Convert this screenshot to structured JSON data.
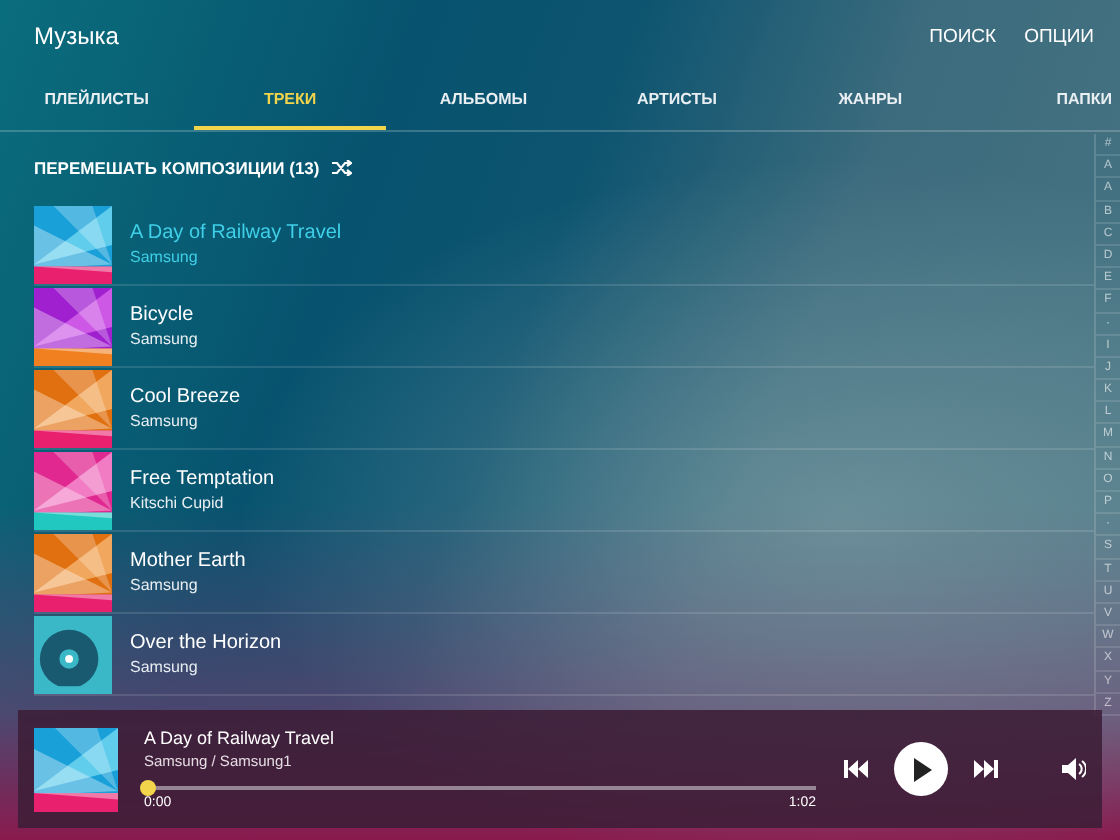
{
  "app": {
    "title": "Музыка",
    "actions": [
      "ПОИСК",
      "ОПЦИИ"
    ]
  },
  "tabs": [
    {
      "label": "ПЛЕЙЛИСТЫ",
      "selected": false
    },
    {
      "label": "ТРЕКИ",
      "selected": true
    },
    {
      "label": "АЛЬБОМЫ",
      "selected": false
    },
    {
      "label": "АРТИСТЫ",
      "selected": false
    },
    {
      "label": "ЖАНРЫ",
      "selected": false
    },
    {
      "label": "ПАПКИ",
      "selected": false
    }
  ],
  "shuffle": {
    "label": "ПЕРЕМЕШАТЬ КОМПОЗИЦИИ (13)"
  },
  "tracks": [
    {
      "title": "A Day of Railway Travel",
      "artist": "Samsung",
      "playing": true
    },
    {
      "title": "Bicycle",
      "artist": "Samsung",
      "playing": false
    },
    {
      "title": "Cool Breeze",
      "artist": "Samsung",
      "playing": false
    },
    {
      "title": "Free Temptation",
      "artist": "Kitschi Cupid",
      "playing": false
    },
    {
      "title": "Mother Earth",
      "artist": "Samsung",
      "playing": false
    },
    {
      "title": "Over the Horizon",
      "artist": "Samsung",
      "playing": false
    }
  ],
  "index": [
    "#",
    "A",
    "A",
    "B",
    "C",
    "D",
    "E",
    "F",
    "·",
    "I",
    "J",
    "K",
    "L",
    "M",
    "N",
    "O",
    "P",
    "·",
    "S",
    "T",
    "U",
    "V",
    "W",
    "X",
    "Y",
    "Z"
  ],
  "player": {
    "title": "A Day of Railway Travel",
    "subtitle": "Samsung / Samsung1",
    "level": 0,
    "elapsed": "0:00",
    "duration": "1:02"
  }
}
